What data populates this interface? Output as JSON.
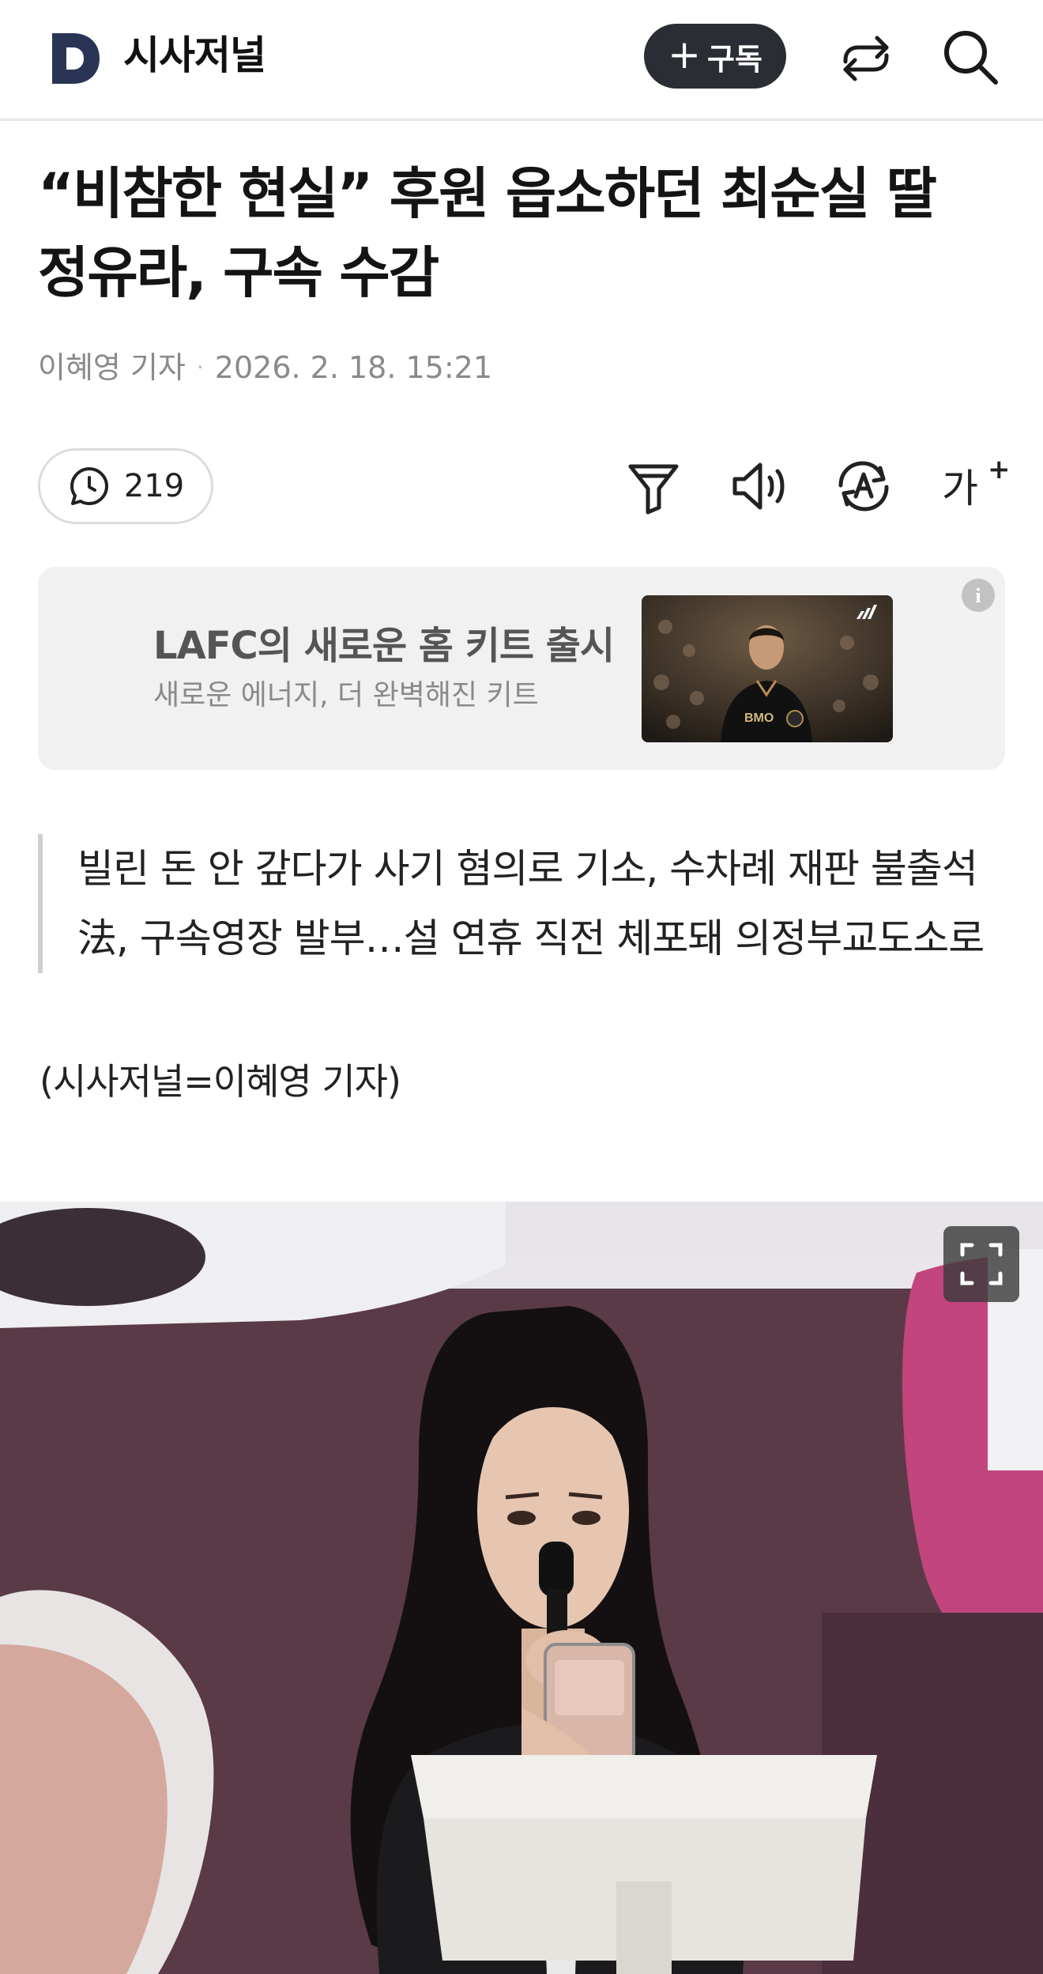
{
  "header": {
    "logo_letter": "D",
    "brand": "시사저널",
    "subscribe_plus": "+",
    "subscribe_label": "구독",
    "icons": [
      "share-icon",
      "search-icon"
    ]
  },
  "article": {
    "title_line1": "“비참한 현실” 후원 읍소하던 최순실 딸",
    "title_line2": "정유라, 구속 수감",
    "author": "이혜영 기자",
    "separator": "·",
    "datetime": "2026. 2. 18. 15:21",
    "summary_line1": "빌린 돈 안 갚다가 사기 혐의로 기소, 수차례 재판 불출석",
    "summary_line2": "法, 구속영장 발부…설 연휴 직전 체포돼 의정부교도소로",
    "byline": "(시사저널=이혜영 기자)"
  },
  "toolbar": {
    "comment_count": "219",
    "font_size_label": "가",
    "icons": [
      "comment-icon",
      "summary-filter-icon",
      "text-to-speech-icon",
      "translate-icon",
      "font-size-icon"
    ]
  },
  "ad": {
    "title": "LAFC의 새로운 홈 키트 출시",
    "subtitle": "새로운 에너지, 더 완벽해진 키트",
    "image_text": "BMO",
    "info_label": "i"
  },
  "colors": {
    "logo": "#2a3556",
    "subscribe_bg": "#2a2d33",
    "ad_bg": "#f1f1f2",
    "photo_bg": "#5a3a46"
  }
}
